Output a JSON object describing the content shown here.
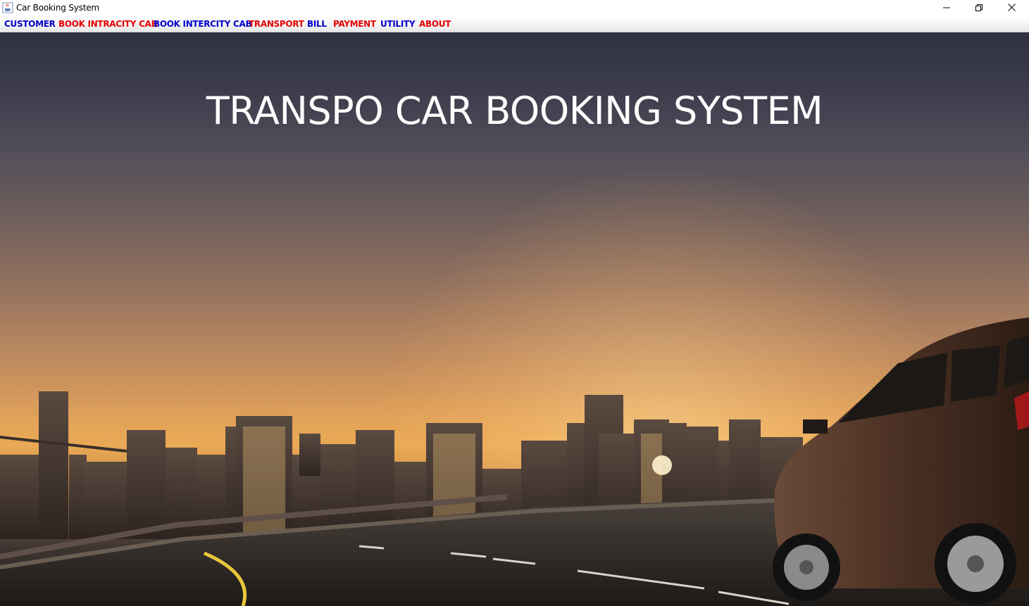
{
  "window": {
    "title": "Car Booking System",
    "app_icon": "java-coffee-icon",
    "controls": {
      "minimize_icon": "minimize-icon",
      "maximize_icon": "restore-icon",
      "close_icon": "close-icon"
    }
  },
  "menu": {
    "items": [
      {
        "label": "CUSTOMER",
        "color": "#0000cc"
      },
      {
        "label": "BOOK INTRACITY CAB",
        "color": "#e60000"
      },
      {
        "label": "BOOK INTERCITY CAB",
        "color": "#0000cc"
      },
      {
        "label": "TRANSPORT",
        "color": "#e60000"
      },
      {
        "label": "BILL",
        "color": "#0000cc"
      },
      {
        "label": "PAYMENT",
        "color": "#e60000"
      },
      {
        "label": "UTILITY",
        "color": "#0000cc"
      },
      {
        "label": "ABOUT",
        "color": "#e60000"
      }
    ]
  },
  "hero": {
    "title": "TRANSPO CAR BOOKING SYSTEM",
    "background": "city-skyline-sunset-with-car"
  }
}
